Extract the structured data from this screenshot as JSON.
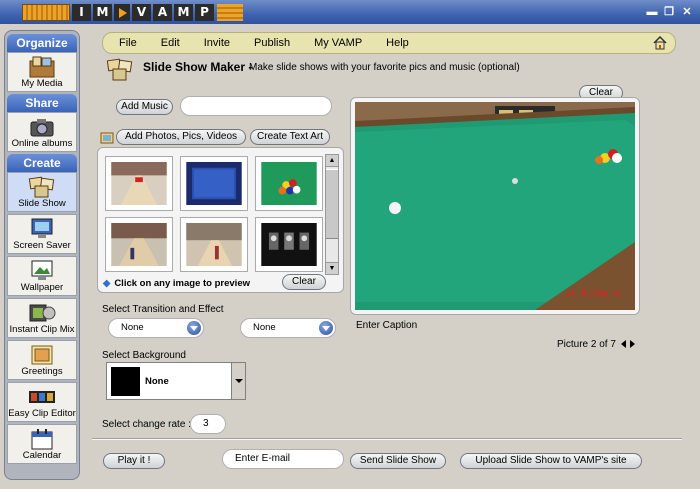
{
  "title_bar": {
    "logo_letters": [
      "I",
      "M",
      "V",
      "A",
      "M",
      "P"
    ],
    "minimize": "▬",
    "restore": "❐",
    "close": "✕"
  },
  "sidebar": {
    "sections": [
      {
        "title": "Organize",
        "items": [
          {
            "label": "My Media",
            "icon": "my-media-icon"
          }
        ]
      },
      {
        "title": "Share",
        "items": [
          {
            "label": "Online albums",
            "icon": "camera-icon"
          }
        ]
      },
      {
        "title": "Create",
        "items": [
          {
            "label": "Slide Show",
            "icon": "slide-show-icon",
            "active": true
          },
          {
            "label": "Screen Saver",
            "icon": "monitor-icon"
          },
          {
            "label": "Wallpaper",
            "icon": "wallpaper-icon"
          },
          {
            "label": "Instant Clip Mix",
            "icon": "film-clip-icon"
          },
          {
            "label": "Greetings",
            "icon": "greeting-card-icon"
          },
          {
            "label": "Easy Clip Editor",
            "icon": "filmstrip-icon"
          },
          {
            "label": "Calendar",
            "icon": "calendar-icon"
          }
        ]
      }
    ]
  },
  "menu": {
    "items": [
      "File",
      "Edit",
      "Invite",
      "Publish",
      "My VAMP",
      "Help"
    ],
    "home_icon": "home-icon"
  },
  "header": {
    "title": "Slide Show Maker",
    "dash": "-",
    "subtitle": "Make slide shows with your favorite pics and music (optional)"
  },
  "music": {
    "button": "Add Music",
    "field_value": ""
  },
  "photos": {
    "add_button": "Add Photos, Pics, Videos",
    "text_art_button": "Create Text Art"
  },
  "thumbnails": {
    "items": [
      "bowling-lanes-1",
      "pool-table-blue",
      "pool-balls-green",
      "bowling-lanes-2",
      "bowling-alley",
      "dark-scene"
    ],
    "hint": "Click on any image to preview",
    "clear_button": "Clear"
  },
  "preview": {
    "clear_button": "Clear",
    "timestamp": "11 8:20p.m.",
    "caption_placeholder": "Enter Caption",
    "counter": "Picture 2 of 7"
  },
  "transition": {
    "label": "Select Transition and Effect",
    "transition_value": "None",
    "effect_value": "None"
  },
  "background": {
    "label": "Select Background",
    "value": "None",
    "swatch_color": "#000000"
  },
  "rate": {
    "label": "Select change rate :",
    "value": "3"
  },
  "footer": {
    "play_button": "Play it !",
    "email_placeholder": "Enter E-mail",
    "send_button": "Send Slide Show",
    "upload_button": "Upload Slide Show to VAMP's site"
  },
  "colors": {
    "title_bar": "#3f63ad",
    "sidebar_header": "#4a74c8",
    "menu_bar": "#e8e4b0",
    "felt": "#1f9a72"
  }
}
